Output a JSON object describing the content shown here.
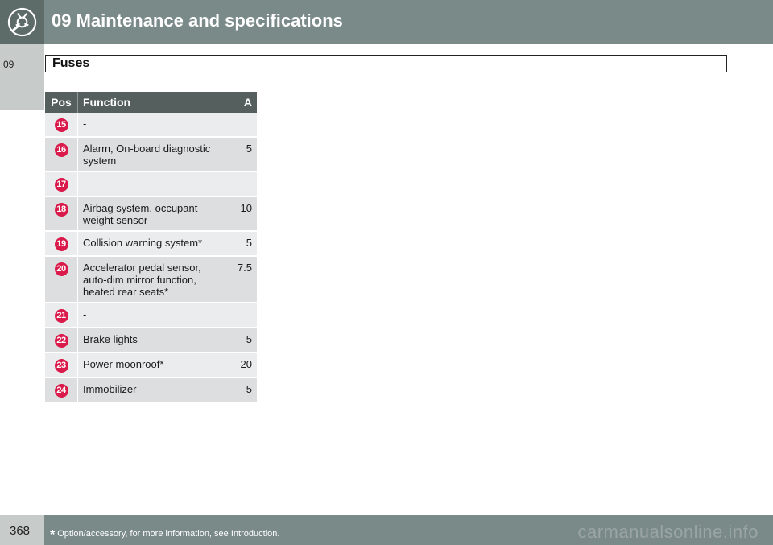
{
  "header": {
    "title": "09 Maintenance and specifications",
    "logo_icon": "wrench-gear-icon"
  },
  "side_tab": {
    "label": "09"
  },
  "section": {
    "title": "Fuses"
  },
  "table": {
    "columns": [
      "Pos",
      "Function",
      "A"
    ],
    "rows": [
      {
        "pos": "15",
        "function": "-",
        "amp": ""
      },
      {
        "pos": "16",
        "function": "Alarm, On-board diagnostic system",
        "amp": "5"
      },
      {
        "pos": "17",
        "function": "-",
        "amp": ""
      },
      {
        "pos": "18",
        "function": "Airbag system, occupant weight sensor",
        "amp": "10"
      },
      {
        "pos": "19",
        "function": "Collision warning system*",
        "amp": "5"
      },
      {
        "pos": "20",
        "function": "Accelerator pedal sensor, auto-dim mirror function, heated rear seats*",
        "amp": "7.5"
      },
      {
        "pos": "21",
        "function": "-",
        "amp": ""
      },
      {
        "pos": "22",
        "function": "Brake lights",
        "amp": "5"
      },
      {
        "pos": "23",
        "function": "Power moonroof*",
        "amp": "20"
      },
      {
        "pos": "24",
        "function": "Immobilizer",
        "amp": "5"
      }
    ]
  },
  "footer": {
    "page_number": "368",
    "footnote_star": "*",
    "footnote_text": "Option/accessory, for more information, see Introduction.",
    "watermark": "carmanualsonline.info"
  },
  "colors": {
    "header_bg": "#7a8a88",
    "table_header_bg": "#545f5e",
    "badge": "#d91a4a"
  }
}
